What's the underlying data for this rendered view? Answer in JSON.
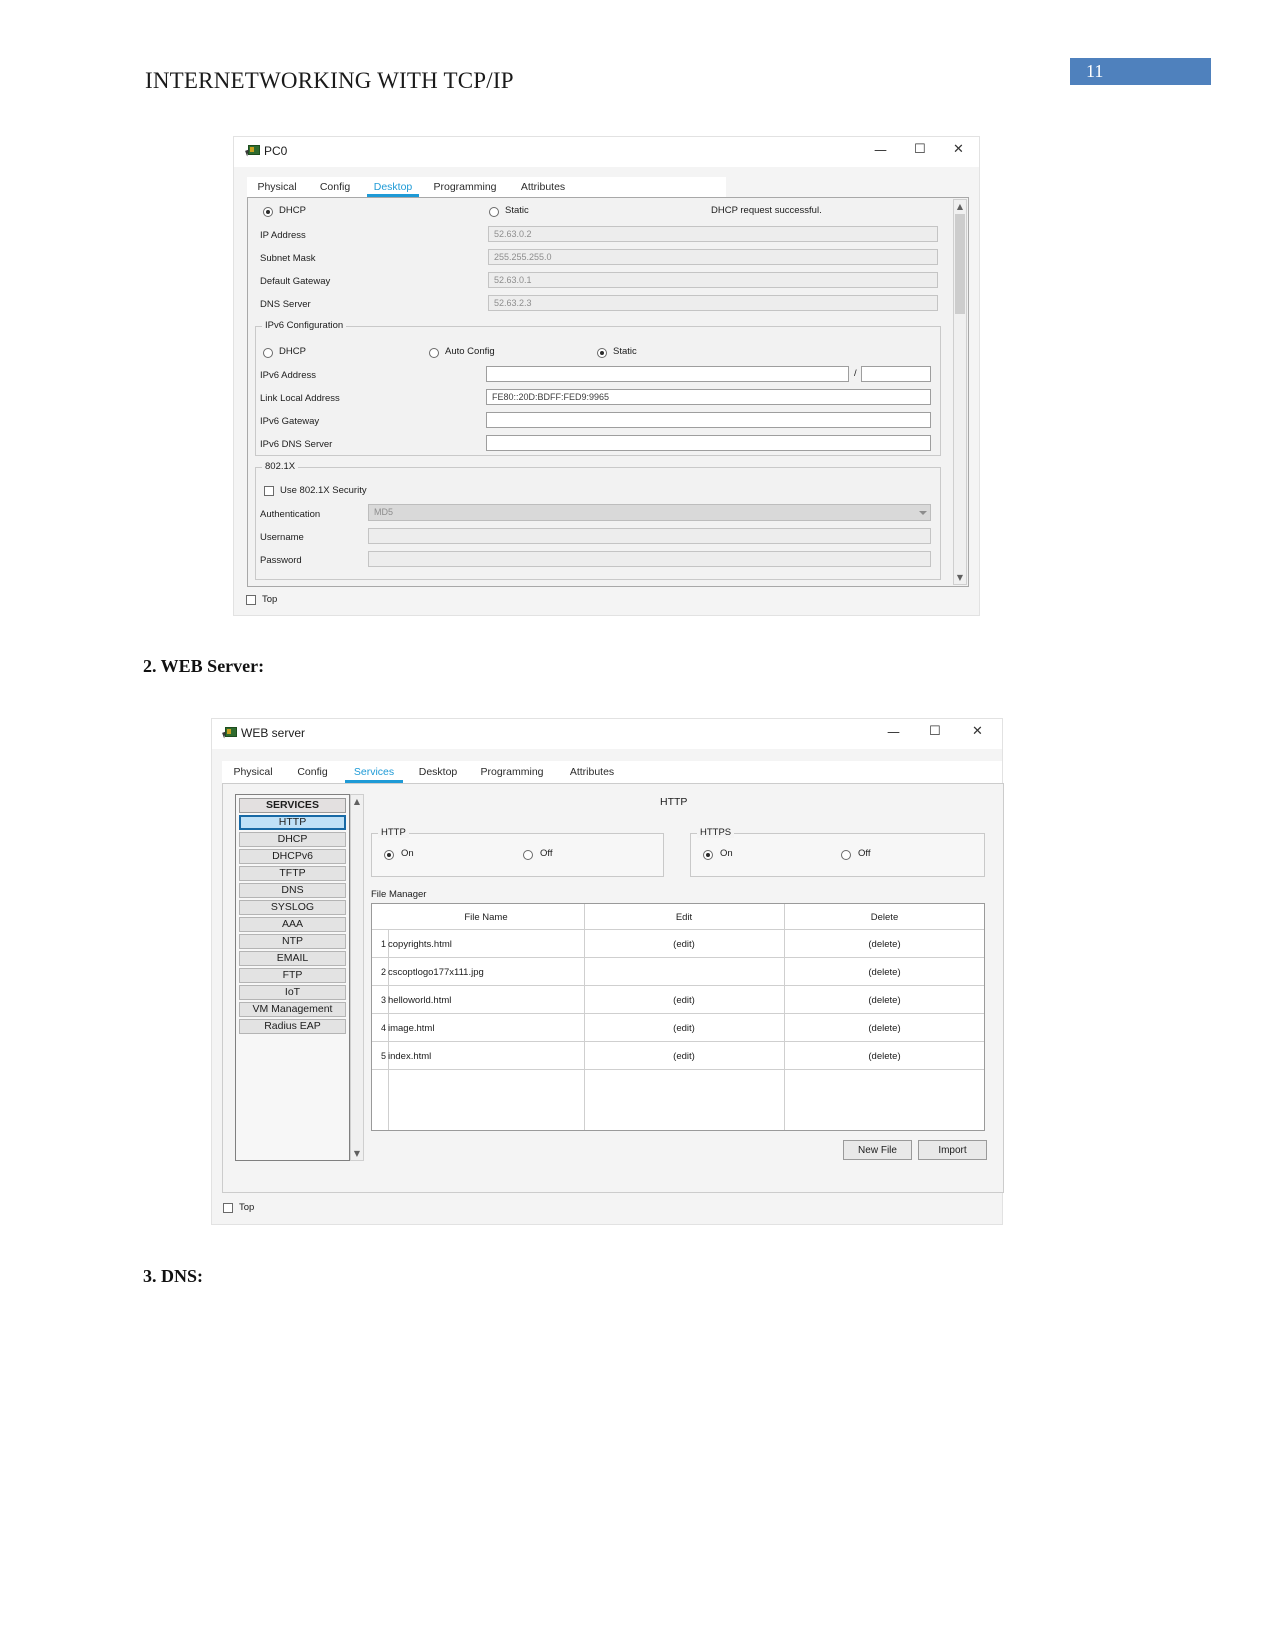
{
  "document": {
    "header_title": "INTERNETWORKING WITH TCP/IP",
    "page_number": "11",
    "accent_color": "#4f81bd",
    "sections": [
      {
        "label": "2. WEB Server:"
      },
      {
        "label": "3. DNS:"
      }
    ]
  },
  "pc_window": {
    "title": "PC0",
    "controls": {
      "minimize": "—",
      "maximize": "☐",
      "close": "✕"
    },
    "tabs": [
      {
        "label": "Physical",
        "active": false
      },
      {
        "label": "Config",
        "active": false
      },
      {
        "label": "Desktop",
        "active": true
      },
      {
        "label": "Programming",
        "active": false
      },
      {
        "label": "Attributes",
        "active": false
      }
    ],
    "ip_config": {
      "dhcp_label": "DHCP",
      "static_label": "Static",
      "status": "DHCP request successful.",
      "selected": "DHCP",
      "fields": [
        {
          "label": "IP Address",
          "value": "52.63.0.2"
        },
        {
          "label": "Subnet Mask",
          "value": "255.255.255.0"
        },
        {
          "label": "Default Gateway",
          "value": "52.63.0.1"
        },
        {
          "label": "DNS Server",
          "value": "52.63.2.3"
        }
      ]
    },
    "ipv6_config": {
      "caption": "IPv6 Configuration",
      "dhcp_label": "DHCP",
      "auto_label": "Auto Config",
      "static_label": "Static",
      "selected": "Static",
      "fields": [
        {
          "label": "IPv6 Address",
          "value": ""
        },
        {
          "label": "Link Local Address",
          "value": "FE80::20D:BDFF:FED9:9965"
        },
        {
          "label": "IPv6 Gateway",
          "value": ""
        },
        {
          "label": "IPv6 DNS Server",
          "value": ""
        }
      ],
      "prefix_value": "",
      "slash": "/"
    },
    "dot1x": {
      "caption": "802.1X",
      "use_security_label": "Use 802.1X Security",
      "use_security_checked": false,
      "auth_label": "Authentication",
      "auth_value": "MD5",
      "username_label": "Username",
      "username_value": "",
      "password_label": "Password",
      "password_value": ""
    },
    "top_checkbox_label": "Top"
  },
  "web_window": {
    "title": "WEB server",
    "controls": {
      "minimize": "—",
      "maximize": "☐",
      "close": "✕"
    },
    "tabs": [
      {
        "label": "Physical",
        "active": false
      },
      {
        "label": "Config",
        "active": false
      },
      {
        "label": "Services",
        "active": true
      },
      {
        "label": "Desktop",
        "active": false
      },
      {
        "label": "Programming",
        "active": false
      },
      {
        "label": "Attributes",
        "active": false
      }
    ],
    "services_sidebar": {
      "header": "SERVICES",
      "selected": "HTTP",
      "items": [
        "HTTP",
        "DHCP",
        "DHCPv6",
        "TFTP",
        "DNS",
        "SYSLOG",
        "AAA",
        "NTP",
        "EMAIL",
        "FTP",
        "IoT",
        "VM Management",
        "Radius EAP"
      ]
    },
    "http_panel": {
      "title": "HTTP",
      "http_group": {
        "caption": "HTTP",
        "on_label": "On",
        "off_label": "Off",
        "selected": "On"
      },
      "https_group": {
        "caption": "HTTPS",
        "on_label": "On",
        "off_label": "Off",
        "selected": "On"
      },
      "file_manager": {
        "caption": "File Manager",
        "columns": [
          "File Name",
          "Edit",
          "Delete"
        ],
        "rows": [
          {
            "index": "1",
            "file_name": "copyrights.html",
            "edit": "(edit)",
            "delete": "(delete)"
          },
          {
            "index": "2",
            "file_name": "cscoptlogo177x111.jpg",
            "edit": "",
            "delete": "(delete)"
          },
          {
            "index": "3",
            "file_name": "helloworld.html",
            "edit": "(edit)",
            "delete": "(delete)"
          },
          {
            "index": "4",
            "file_name": "image.html",
            "edit": "(edit)",
            "delete": "(delete)"
          },
          {
            "index": "5",
            "file_name": "index.html",
            "edit": "(edit)",
            "delete": "(delete)"
          }
        ],
        "new_file_button": "New File",
        "import_button": "Import"
      }
    },
    "top_checkbox_label": "Top"
  }
}
